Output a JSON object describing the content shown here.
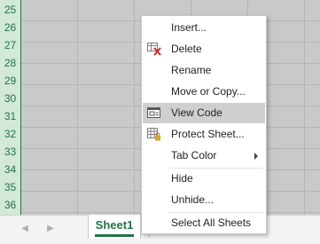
{
  "grid": {
    "rows": [
      "25",
      "26",
      "27",
      "28",
      "29",
      "30",
      "31",
      "32",
      "33",
      "34",
      "35",
      "36"
    ]
  },
  "tab_bar": {
    "prev_icon": "triangle-left",
    "next_icon": "triangle-right",
    "sheet_tab": "Sheet1",
    "add_sheet_icon": "plus"
  },
  "context_menu": {
    "insert": "Insert...",
    "delete": "Delete",
    "rename": "Rename",
    "move_or_copy": "Move or Copy...",
    "view_code": "View Code",
    "protect_sheet": "Protect Sheet...",
    "tab_color": "Tab Color",
    "hide": "Hide",
    "unhide": "Unhide...",
    "select_all_sheets": "Select All Sheets"
  },
  "colors": {
    "accent": "#217346",
    "menu_highlight": "#cfcfcf",
    "delete_icon_x": "#d9252c",
    "protect_lock": "#e0a31e"
  }
}
